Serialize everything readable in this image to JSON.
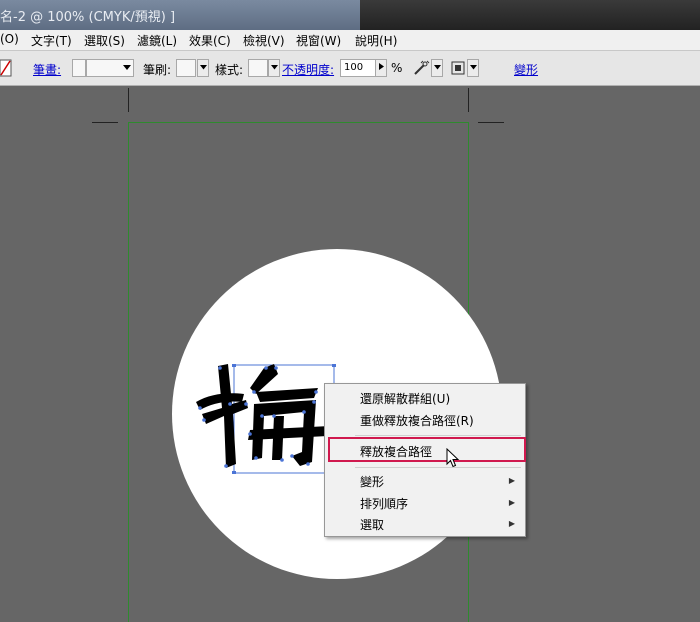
{
  "window": {
    "title": "名-2 @ 100% (CMYK/預視) ]"
  },
  "menu": {
    "items": [
      "(O)",
      "文字(T)",
      "選取(S)",
      "濾鏡(L)",
      "效果(C)",
      "檢視(V)",
      "視窗(W)",
      "說明(H)"
    ]
  },
  "toolbar": {
    "stroke_label": "筆畫:",
    "brush_label": "筆刷:",
    "style_label": "樣式:",
    "opacity_label": "不透明度:",
    "opacity_value": "100",
    "opacity_unit": "%",
    "transform_label": "變形"
  },
  "artwork": {
    "character": "梅"
  },
  "context_menu": {
    "items": [
      "還原解散群組(U)",
      "重做釋放複合路徑(R)",
      "釋放複合路徑",
      "變形",
      "排列順序",
      "選取"
    ],
    "submenu_arrow": "▶",
    "highlight_color": "#d0194e"
  }
}
